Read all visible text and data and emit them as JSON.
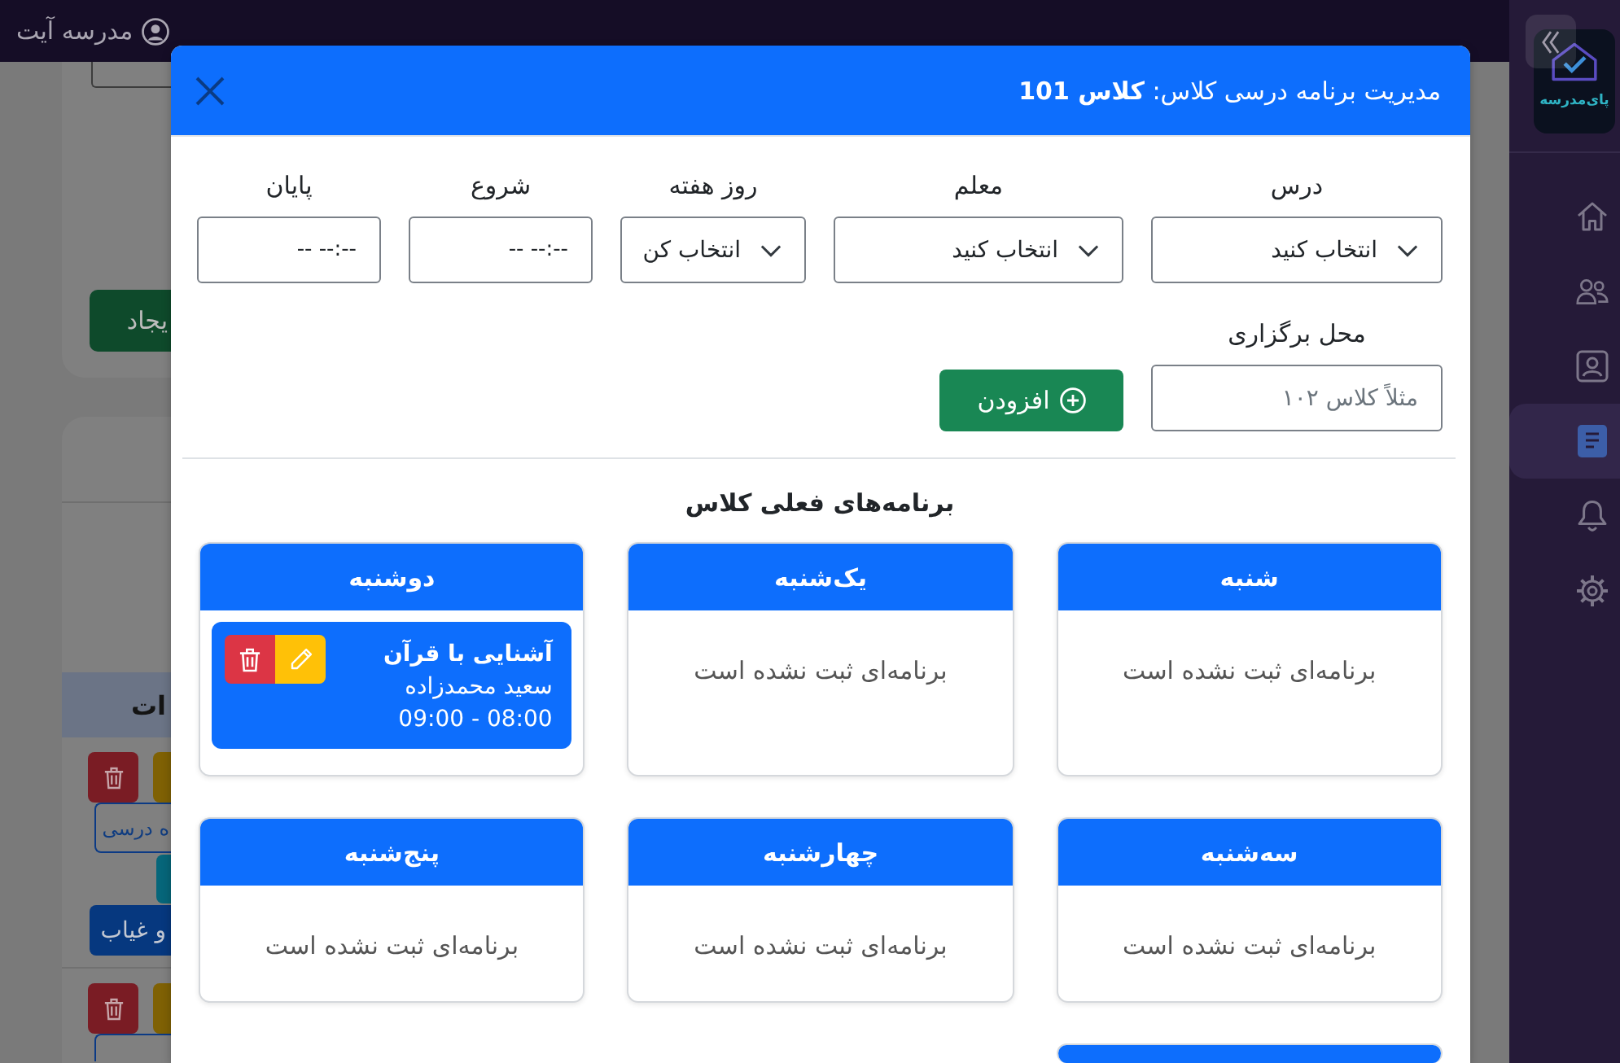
{
  "top_bar": {
    "user": "مدرسه آیت"
  },
  "sidebar": {
    "logo": "پای‌مدرسه",
    "items": [
      {
        "selected": false
      },
      {
        "selected": false
      },
      {
        "selected": false
      },
      {
        "selected": true
      },
      {
        "selected": false
      },
      {
        "selected": false
      }
    ]
  },
  "background": {
    "create_button": "یجاد",
    "table_header": "ات",
    "rows": [
      {
        "kind": "full",
        "plan_button": "ه درسی",
        "attendance_button": "و غیاب"
      },
      {
        "kind": "cut"
      }
    ]
  },
  "modal": {
    "title": "مدیریت برنامه درسی کلاس: **کلاس 101**",
    "fields": [
      {
        "kind": "select",
        "label": "درس",
        "value": "انتخاب کنید"
      },
      {
        "kind": "select",
        "label": "معلم",
        "value": "انتخاب کنید"
      },
      {
        "kind": "select",
        "label": "روز هفته",
        "value": "انتخاب کن"
      },
      {
        "kind": "time",
        "label": "شروع",
        "placeholder": "--:-- --"
      },
      {
        "kind": "time",
        "label": "پایان",
        "placeholder": "--:-- --"
      },
      {
        "kind": "text",
        "label": "محل برگزاری",
        "placeholder": "مثلاً کلاس ۱۰۲"
      }
    ],
    "add_button": "افزودن",
    "section_title": "برنامه‌های فعلی کلاس",
    "days": [
      {
        "kind": "empty",
        "name": "شنبه",
        "message": "برنامه‌ای ثبت نشده است"
      },
      {
        "kind": "empty",
        "name": "یک‌شنبه",
        "message": "برنامه‌ای ثبت نشده است"
      },
      {
        "kind": "filled",
        "name": "دوشنبه",
        "entries": [
          {
            "title": "آشنایی با قرآن",
            "teacher": "سعید محمدزاده",
            "time": "08:00 - 09:00"
          }
        ]
      },
      {
        "kind": "empty",
        "name": "سه‌شنبه",
        "message": "برنامه‌ای ثبت نشده است"
      },
      {
        "kind": "empty",
        "name": "چهارشنبه",
        "message": "برنامه‌ای ثبت نشده است"
      },
      {
        "kind": "empty",
        "name": "پنج‌شنبه",
        "message": "برنامه‌ای ثبت نشده است"
      },
      {
        "kind": "cut"
      }
    ]
  }
}
